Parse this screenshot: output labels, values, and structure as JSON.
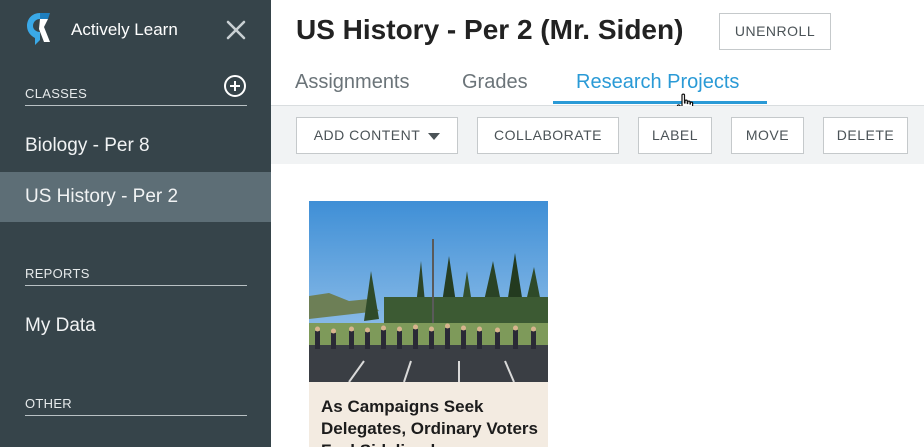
{
  "sidebar": {
    "brand": "Actively Learn",
    "sections": {
      "classes": "CLASSES",
      "reports": "REPORTS",
      "other": "OTHER"
    },
    "classes": [
      {
        "label": "Biology - Per 8",
        "active": false
      },
      {
        "label": "US History - Per 2",
        "active": true
      }
    ],
    "reports": [
      {
        "label": "My Data"
      }
    ]
  },
  "header": {
    "title": "US History - Per 2 (Mr. Siden)",
    "unenroll_label": "UNENROLL"
  },
  "tabs": [
    {
      "label": "Assignments",
      "active": false
    },
    {
      "label": "Grades",
      "active": false
    },
    {
      "label": "Research Projects",
      "active": true
    }
  ],
  "toolbar": {
    "add_content": "ADD CONTENT",
    "collaborate": "COLLABORATE",
    "label": "LABEL",
    "move": "MOVE",
    "delete": "DELETE"
  },
  "cards": [
    {
      "title": "As Campaigns Seek Delegates, Ordinary Voters Feel Sidelined"
    }
  ],
  "colors": {
    "sidebar_bg": "#36444a",
    "sidebar_active": "#5d6e76",
    "accent": "#2a9ad6",
    "toolbar_bg": "#f1f3f4"
  }
}
